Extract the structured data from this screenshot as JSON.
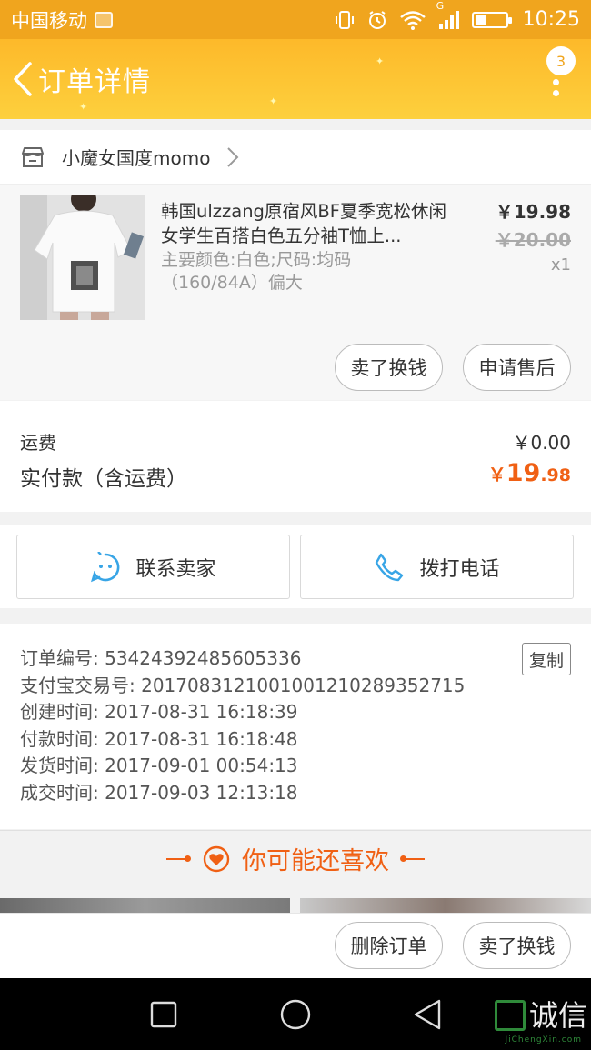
{
  "status_bar": {
    "carrier": "中国移动",
    "network": "G",
    "time": "10:25",
    "battery_level": 0.4
  },
  "header": {
    "title": "订单详情",
    "badge_count": "3"
  },
  "shop": {
    "name": "小魔女国度momo"
  },
  "item": {
    "title": "韩国ulzzang原宿风BF夏季宽松休闲女学生百搭白色五分袖T恤上...",
    "sku": "主要颜色:白色;尺码:均码（160/84A）偏大",
    "price": "￥19.98",
    "original_price": "￥20.00",
    "quantity": "x1"
  },
  "item_actions": {
    "sell": "卖了换钱",
    "after_sale": "申请售后"
  },
  "fees": {
    "shipping_label": "运费",
    "shipping_value": "￥0.00",
    "paid_label": "实付款（含运费）",
    "paid_currency": "￥",
    "paid_int": "19",
    "paid_dec": ".98"
  },
  "contact": {
    "seller_label": "联系卖家",
    "phone_label": "拨打电话"
  },
  "order_info": {
    "copy_label": "复制",
    "lines": [
      "订单编号: 53424392485605336",
      "支付宝交易号: 2017083121001001210289352715",
      "创建时间: 2017-08-31 16:18:39",
      "付款时间: 2017-08-31 16:18:48",
      "发货时间: 2017-09-01 00:54:13",
      "成交时间: 2017-09-03 12:13:18"
    ]
  },
  "recommend": {
    "title": "你可能还喜欢"
  },
  "bottom_actions": {
    "delete": "删除订单",
    "sell": "卖了换钱"
  },
  "watermark": {
    "text": "诚信",
    "sub": "JiChengXin.com"
  },
  "colors": {
    "accent": "#f0a51e",
    "price_orange": "#f06014",
    "header_gradient_top": "#fdb92a"
  }
}
